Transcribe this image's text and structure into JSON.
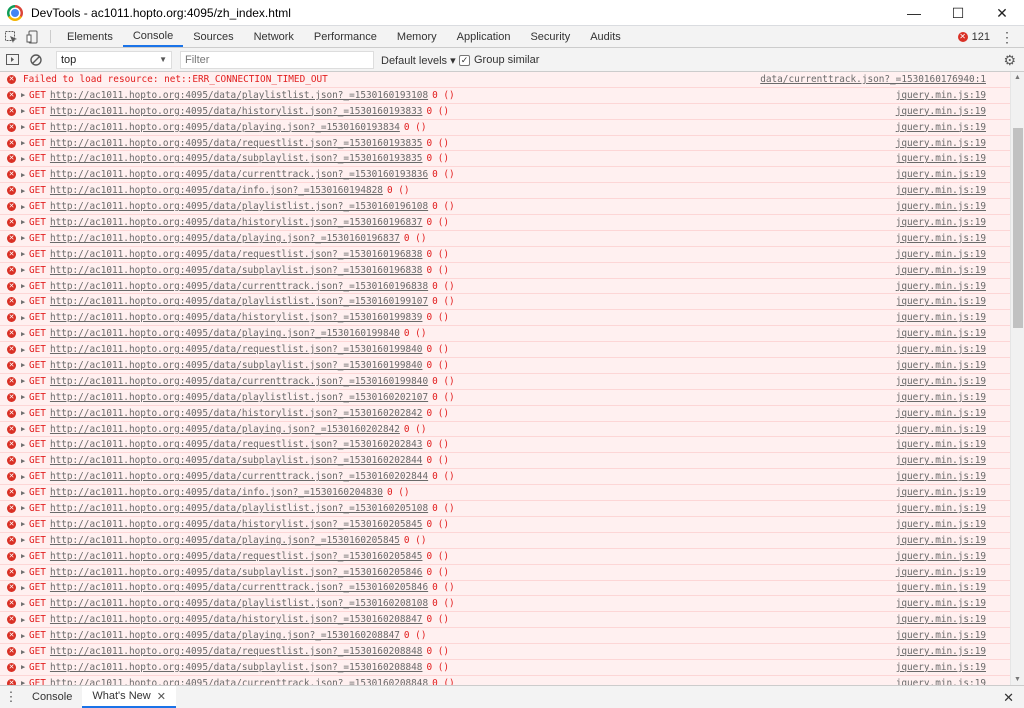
{
  "window": {
    "title": "DevTools - ac1011.hopto.org:4095/zh_index.html",
    "minimize": "—",
    "maximize": "☐",
    "close": "✕"
  },
  "tabs": [
    "Elements",
    "Console",
    "Sources",
    "Network",
    "Performance",
    "Memory",
    "Application",
    "Security",
    "Audits"
  ],
  "active_tab": "Console",
  "error_count": "121",
  "toolbar": {
    "context": "top",
    "filter_placeholder": "Filter",
    "levels": "Default levels ▾",
    "group_similar": "Group similar"
  },
  "first_message": {
    "text": "Failed to load resource: net::ERR_CONNECTION_TIMED_OUT",
    "source": "data/currenttrack.json?_=1530160176940:1"
  },
  "rows": [
    {
      "method": "GET",
      "url": "http://ac1011.hopto.org:4095/data/playlistlist.json?_=1530160193108",
      "status": "0 ()",
      "source": "jquery.min.js:19"
    },
    {
      "method": "GET",
      "url": "http://ac1011.hopto.org:4095/data/historylist.json?_=1530160193833",
      "status": "0 ()",
      "source": "jquery.min.js:19"
    },
    {
      "method": "GET",
      "url": "http://ac1011.hopto.org:4095/data/playing.json?_=1530160193834",
      "status": "0 ()",
      "source": "jquery.min.js:19"
    },
    {
      "method": "GET",
      "url": "http://ac1011.hopto.org:4095/data/requestlist.json?_=1530160193835",
      "status": "0 ()",
      "source": "jquery.min.js:19"
    },
    {
      "method": "GET",
      "url": "http://ac1011.hopto.org:4095/data/subplaylist.json?_=1530160193835",
      "status": "0 ()",
      "source": "jquery.min.js:19"
    },
    {
      "method": "GET",
      "url": "http://ac1011.hopto.org:4095/data/currenttrack.json?_=1530160193836",
      "status": "0 ()",
      "source": "jquery.min.js:19"
    },
    {
      "method": "GET",
      "url": "http://ac1011.hopto.org:4095/data/info.json?_=1530160194828",
      "status": "0 ()",
      "source": "jquery.min.js:19"
    },
    {
      "method": "GET",
      "url": "http://ac1011.hopto.org:4095/data/playlistlist.json?_=1530160196108",
      "status": "0 ()",
      "source": "jquery.min.js:19"
    },
    {
      "method": "GET",
      "url": "http://ac1011.hopto.org:4095/data/historylist.json?_=1530160196837",
      "status": "0 ()",
      "source": "jquery.min.js:19"
    },
    {
      "method": "GET",
      "url": "http://ac1011.hopto.org:4095/data/playing.json?_=1530160196837",
      "status": "0 ()",
      "source": "jquery.min.js:19"
    },
    {
      "method": "GET",
      "url": "http://ac1011.hopto.org:4095/data/requestlist.json?_=1530160196838",
      "status": "0 ()",
      "source": "jquery.min.js:19"
    },
    {
      "method": "GET",
      "url": "http://ac1011.hopto.org:4095/data/subplaylist.json?_=1530160196838",
      "status": "0 ()",
      "source": "jquery.min.js:19"
    },
    {
      "method": "GET",
      "url": "http://ac1011.hopto.org:4095/data/currenttrack.json?_=1530160196838",
      "status": "0 ()",
      "source": "jquery.min.js:19"
    },
    {
      "method": "GET",
      "url": "http://ac1011.hopto.org:4095/data/playlistlist.json?_=1530160199107",
      "status": "0 ()",
      "source": "jquery.min.js:19"
    },
    {
      "method": "GET",
      "url": "http://ac1011.hopto.org:4095/data/historylist.json?_=1530160199839",
      "status": "0 ()",
      "source": "jquery.min.js:19"
    },
    {
      "method": "GET",
      "url": "http://ac1011.hopto.org:4095/data/playing.json?_=1530160199840",
      "status": "0 ()",
      "source": "jquery.min.js:19"
    },
    {
      "method": "GET",
      "url": "http://ac1011.hopto.org:4095/data/requestlist.json?_=1530160199840",
      "status": "0 ()",
      "source": "jquery.min.js:19"
    },
    {
      "method": "GET",
      "url": "http://ac1011.hopto.org:4095/data/subplaylist.json?_=1530160199840",
      "status": "0 ()",
      "source": "jquery.min.js:19"
    },
    {
      "method": "GET",
      "url": "http://ac1011.hopto.org:4095/data/currenttrack.json?_=1530160199840",
      "status": "0 ()",
      "source": "jquery.min.js:19"
    },
    {
      "method": "GET",
      "url": "http://ac1011.hopto.org:4095/data/playlistlist.json?_=1530160202107",
      "status": "0 ()",
      "source": "jquery.min.js:19"
    },
    {
      "method": "GET",
      "url": "http://ac1011.hopto.org:4095/data/historylist.json?_=1530160202842",
      "status": "0 ()",
      "source": "jquery.min.js:19"
    },
    {
      "method": "GET",
      "url": "http://ac1011.hopto.org:4095/data/playing.json?_=1530160202842",
      "status": "0 ()",
      "source": "jquery.min.js:19"
    },
    {
      "method": "GET",
      "url": "http://ac1011.hopto.org:4095/data/requestlist.json?_=1530160202843",
      "status": "0 ()",
      "source": "jquery.min.js:19"
    },
    {
      "method": "GET",
      "url": "http://ac1011.hopto.org:4095/data/subplaylist.json?_=1530160202844",
      "status": "0 ()",
      "source": "jquery.min.js:19"
    },
    {
      "method": "GET",
      "url": "http://ac1011.hopto.org:4095/data/currenttrack.json?_=1530160202844",
      "status": "0 ()",
      "source": "jquery.min.js:19"
    },
    {
      "method": "GET",
      "url": "http://ac1011.hopto.org:4095/data/info.json?_=1530160204830",
      "status": "0 ()",
      "source": "jquery.min.js:19"
    },
    {
      "method": "GET",
      "url": "http://ac1011.hopto.org:4095/data/playlistlist.json?_=1530160205108",
      "status": "0 ()",
      "source": "jquery.min.js:19"
    },
    {
      "method": "GET",
      "url": "http://ac1011.hopto.org:4095/data/historylist.json?_=1530160205845",
      "status": "0 ()",
      "source": "jquery.min.js:19"
    },
    {
      "method": "GET",
      "url": "http://ac1011.hopto.org:4095/data/playing.json?_=1530160205845",
      "status": "0 ()",
      "source": "jquery.min.js:19"
    },
    {
      "method": "GET",
      "url": "http://ac1011.hopto.org:4095/data/requestlist.json?_=1530160205845",
      "status": "0 ()",
      "source": "jquery.min.js:19"
    },
    {
      "method": "GET",
      "url": "http://ac1011.hopto.org:4095/data/subplaylist.json?_=1530160205846",
      "status": "0 ()",
      "source": "jquery.min.js:19"
    },
    {
      "method": "GET",
      "url": "http://ac1011.hopto.org:4095/data/currenttrack.json?_=1530160205846",
      "status": "0 ()",
      "source": "jquery.min.js:19"
    },
    {
      "method": "GET",
      "url": "http://ac1011.hopto.org:4095/data/playlistlist.json?_=1530160208108",
      "status": "0 ()",
      "source": "jquery.min.js:19"
    },
    {
      "method": "GET",
      "url": "http://ac1011.hopto.org:4095/data/historylist.json?_=1530160208847",
      "status": "0 ()",
      "source": "jquery.min.js:19"
    },
    {
      "method": "GET",
      "url": "http://ac1011.hopto.org:4095/data/playing.json?_=1530160208847",
      "status": "0 ()",
      "source": "jquery.min.js:19"
    },
    {
      "method": "GET",
      "url": "http://ac1011.hopto.org:4095/data/requestlist.json?_=1530160208848",
      "status": "0 ()",
      "source": "jquery.min.js:19"
    },
    {
      "method": "GET",
      "url": "http://ac1011.hopto.org:4095/data/subplaylist.json?_=1530160208848",
      "status": "0 ()",
      "source": "jquery.min.js:19"
    },
    {
      "method": "GET",
      "url": "http://ac1011.hopto.org:4095/data/currenttrack.json?_=1530160208848",
      "status": "0 ()",
      "source": "jquery.min.js:19"
    }
  ],
  "drawer": {
    "tabs": [
      "Console",
      "What's New"
    ],
    "active": "What's New"
  },
  "colors": {
    "error_text": "#e21e1e",
    "error_background": "#fff0f0",
    "accent": "#1a73e8"
  }
}
